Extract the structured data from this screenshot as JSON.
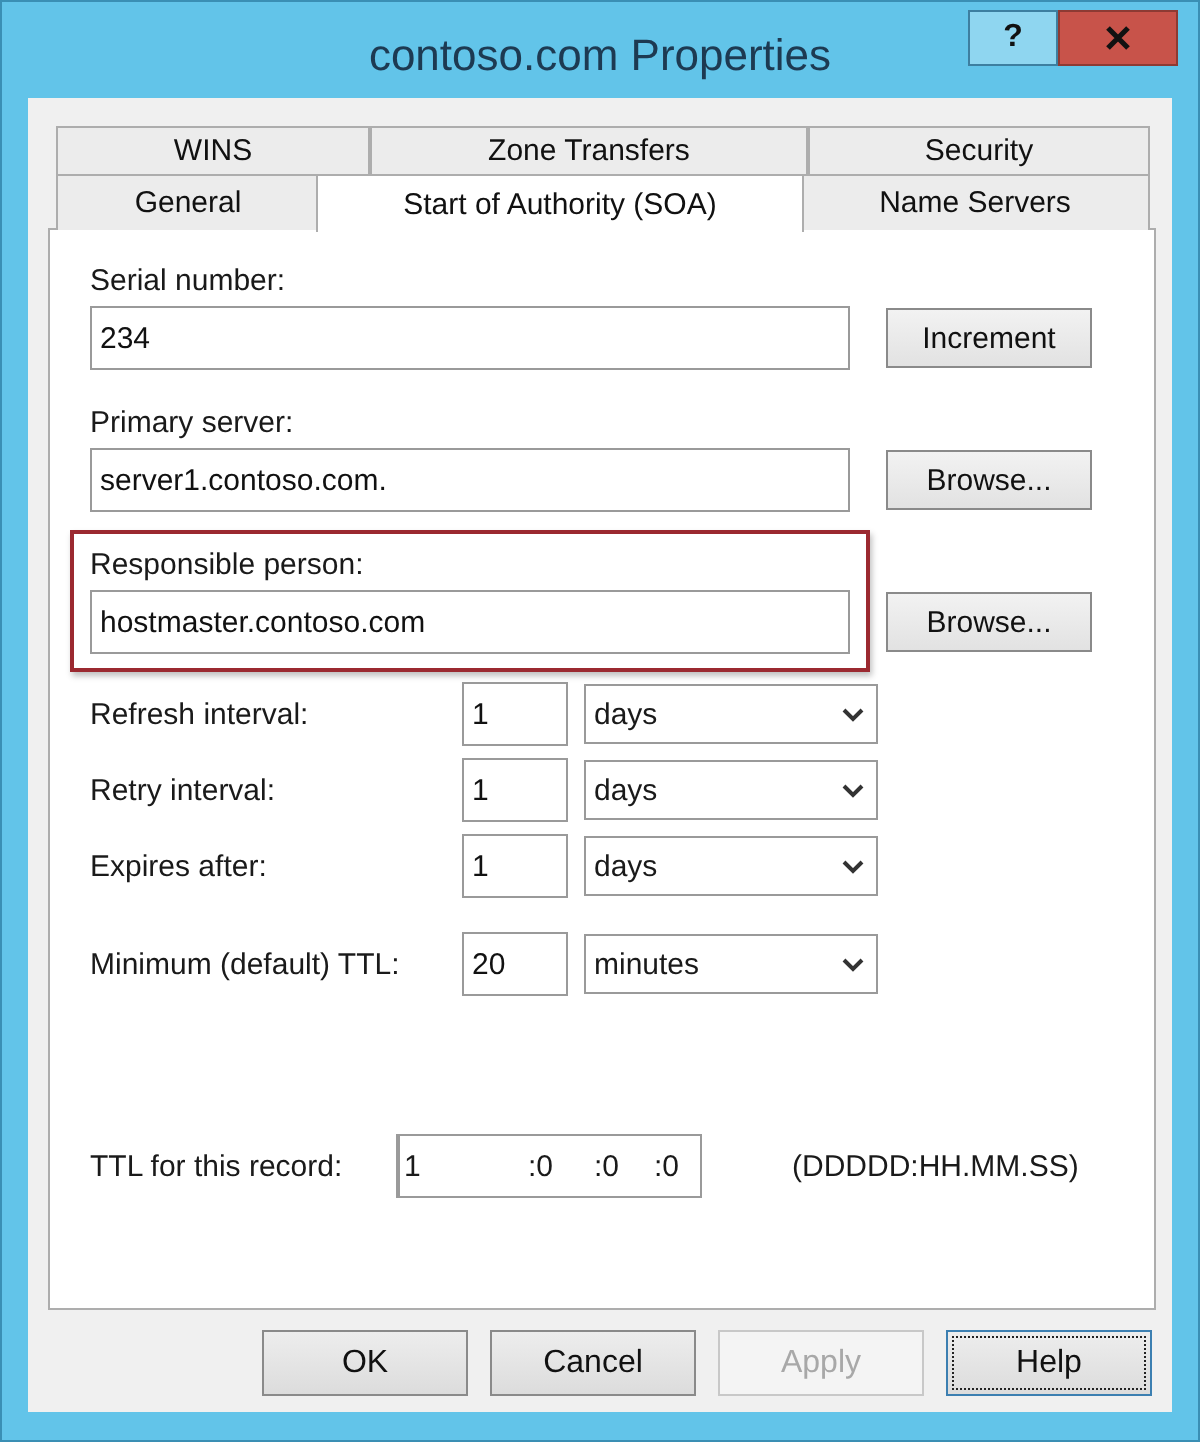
{
  "window": {
    "title": "contoso.com Properties",
    "help_label": "?"
  },
  "tab_rows": [
    {
      "tabs": [
        {
          "label": "WINS",
          "selected": false
        },
        {
          "label": "Zone Transfers",
          "selected": false
        },
        {
          "label": "Security",
          "selected": false
        }
      ]
    },
    {
      "tabs": [
        {
          "label": "General",
          "selected": false
        },
        {
          "label": "Start of Authority (SOA)",
          "selected": true
        },
        {
          "label": "Name Servers",
          "selected": false
        }
      ]
    }
  ],
  "fields": [
    {
      "label": "Serial number:",
      "value": "234",
      "button": "Increment",
      "highlighted": false
    },
    {
      "label": "Primary server:",
      "value": "server1.contoso.com.",
      "button": "Browse...",
      "highlighted": false
    },
    {
      "label": "Responsible person:",
      "value": "hostmaster.contoso.com",
      "button": "Browse...",
      "highlighted": true
    }
  ],
  "intervals": [
    {
      "label": "Refresh interval:",
      "value": "1",
      "unit": "days"
    },
    {
      "label": "Retry interval:",
      "value": "1",
      "unit": "days"
    },
    {
      "label": "Expires after:",
      "value": "1",
      "unit": "days"
    },
    {
      "label": "Minimum (default) TTL:",
      "value": "20",
      "unit": "minutes"
    }
  ],
  "ttl": {
    "label": "TTL for this record:",
    "parts": [
      "1",
      ":0",
      ":0",
      ":0"
    ],
    "format": "(DDDDD:HH.MM.SS)"
  },
  "buttons": [
    {
      "label": "OK",
      "disabled": false,
      "focused": false
    },
    {
      "label": "Cancel",
      "disabled": false,
      "focused": false
    },
    {
      "label": "Apply",
      "disabled": true,
      "focused": false
    },
    {
      "label": "Help",
      "disabled": false,
      "focused": true
    }
  ]
}
